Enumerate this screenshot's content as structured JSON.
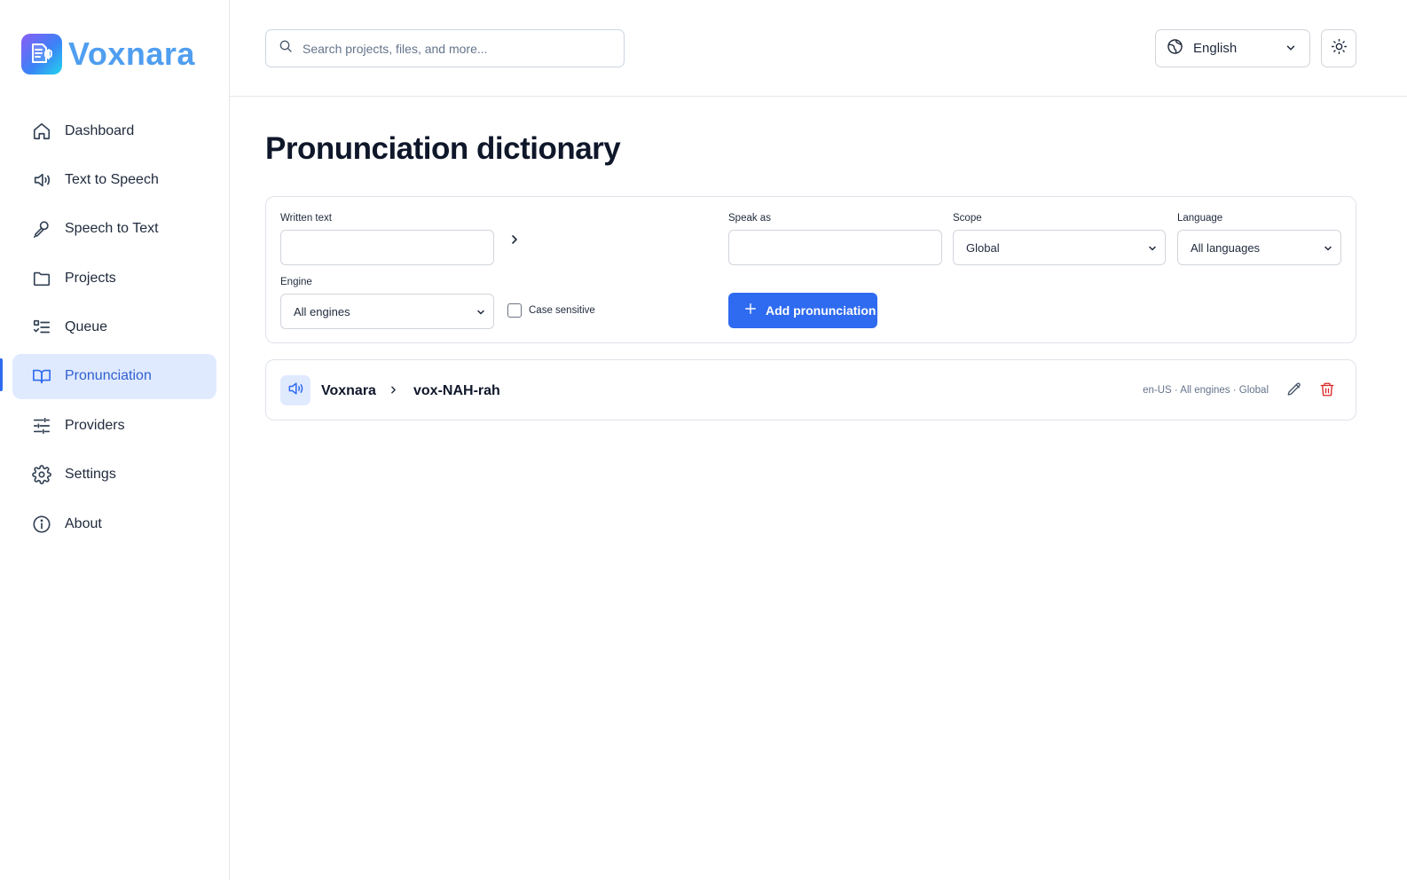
{
  "app": {
    "name": "Voxnara"
  },
  "sidebar": {
    "items": [
      {
        "label": "Dashboard",
        "icon": "home-icon",
        "active": false
      },
      {
        "label": "Text to Speech",
        "icon": "speaker-icon",
        "active": false
      },
      {
        "label": "Speech to Text",
        "icon": "microphone-icon",
        "active": false
      },
      {
        "label": "Projects",
        "icon": "folder-icon",
        "active": false
      },
      {
        "label": "Queue",
        "icon": "checklist-icon",
        "active": false
      },
      {
        "label": "Pronunciation",
        "icon": "book-icon",
        "active": true
      },
      {
        "label": "Providers",
        "icon": "sliders-icon",
        "active": false
      },
      {
        "label": "Settings",
        "icon": "gear-icon",
        "active": false
      },
      {
        "label": "About",
        "icon": "info-icon",
        "active": false
      }
    ]
  },
  "header": {
    "search_placeholder": "Search projects, files, and more...",
    "language": "English",
    "theme_icon": "sun-icon"
  },
  "main": {
    "title": "Pronunciation dictionary",
    "form": {
      "written_label": "Written text",
      "written_value": "",
      "speak_as_label": "Speak as",
      "speak_as_value": "",
      "scope_label": "Scope",
      "scope_value": "Global",
      "language_label": "Language",
      "language_value": "All languages",
      "engine_label": "Engine",
      "engine_value": "All engines",
      "case_sensitive_label": "Case sensitive",
      "case_sensitive_checked": false,
      "add_label": "Add pronunciation"
    },
    "entries": [
      {
        "written": "Voxnara",
        "spoken": "vox-NAH-rah",
        "meta": "en-US · All engines · Global"
      }
    ]
  },
  "colors": {
    "accent": "#2f6bf0",
    "active_bg": "#e0eaff",
    "delete": "#dc2626",
    "logo_text": "#4f9ef0"
  }
}
